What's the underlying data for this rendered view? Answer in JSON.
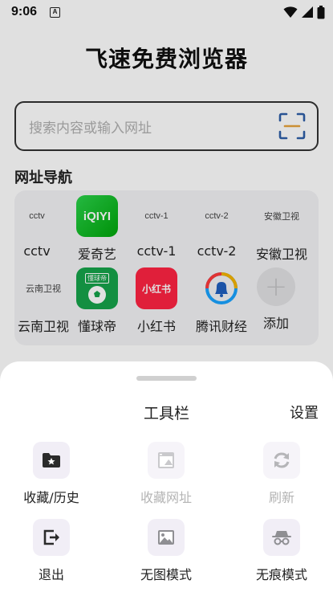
{
  "status_bar": {
    "time": "9:06",
    "notification_icon_letter": "A"
  },
  "app": {
    "title": "飞速免费浏览器"
  },
  "search": {
    "placeholder": "搜索内容或输入网址"
  },
  "nav": {
    "section_title": "网址导航",
    "items": [
      {
        "label": "cctv",
        "icon_text": "cctv",
        "icon": "text"
      },
      {
        "label": "爱奇艺",
        "icon_text": "iQIYI",
        "icon": "iqiyi-logo-icon"
      },
      {
        "label": "cctv-1",
        "icon_text": "cctv-1",
        "icon": "text"
      },
      {
        "label": "cctv-2",
        "icon_text": "cctv-2",
        "icon": "text"
      },
      {
        "label": "安徽卫视",
        "icon_text": "安徽卫视",
        "icon": "text"
      },
      {
        "label": "云南卫视",
        "icon_text": "云南卫视",
        "icon": "text"
      },
      {
        "label": "懂球帝",
        "icon_text": "懂球帝",
        "icon": "dongqiudi-logo-icon"
      },
      {
        "label": "小红书",
        "icon_text": "小红书",
        "icon": "xiaohongshu-logo-icon"
      },
      {
        "label": "腾讯财经",
        "icon_text": "",
        "icon": "tencent-finance-logo-icon"
      },
      {
        "label": "添加",
        "icon_text": "+",
        "icon": "add-icon"
      }
    ]
  },
  "toolbar": {
    "title": "工具栏",
    "settings_label": "设置",
    "tools": [
      {
        "label": "收藏/历史",
        "icon": "folder-star-icon",
        "enabled": true
      },
      {
        "label": "收藏网址",
        "icon": "bookmark-page-icon",
        "enabled": false
      },
      {
        "label": "刷新",
        "icon": "refresh-icon",
        "enabled": false
      },
      {
        "label": "退出",
        "icon": "exit-icon",
        "enabled": true
      },
      {
        "label": "无图模式",
        "icon": "image-icon",
        "enabled": true
      },
      {
        "label": "无痕模式",
        "icon": "incognito-icon",
        "enabled": true
      }
    ]
  },
  "colors": {
    "accent": "#2f5fa8",
    "iqiyi_green": "#00be06",
    "dongqiudi_green": "#16a34a",
    "xiaohongshu_red": "#ff2442",
    "icon_tile_bg": "#f1eef6",
    "disabled_text": "#b4b4b4"
  }
}
